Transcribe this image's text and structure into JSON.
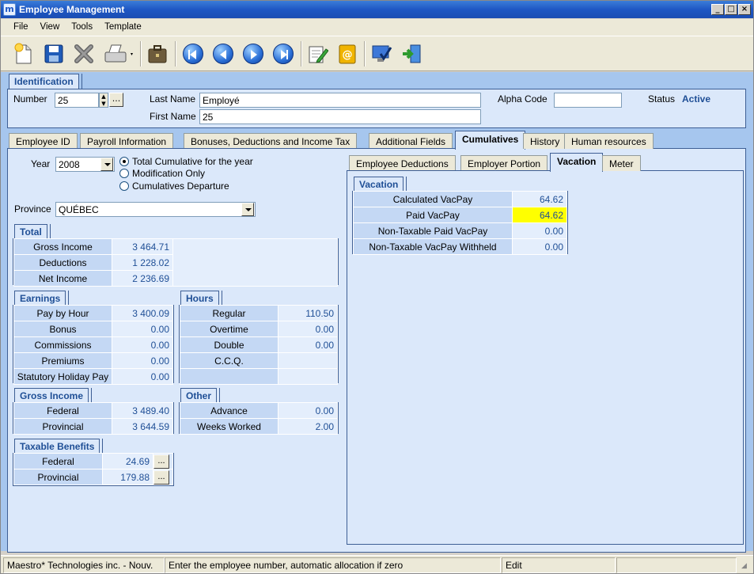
{
  "window": {
    "title": "Employee Management",
    "app_icon": "m"
  },
  "menu": [
    "File",
    "View",
    "Tools",
    "Template"
  ],
  "identification": {
    "caption": "Identification",
    "number_label": "Number",
    "number_value": "25",
    "lastname_label": "Last Name",
    "lastname_value": "Employé",
    "firstname_label": "First Name",
    "firstname_value": "25",
    "alpha_label": "Alpha Code",
    "alpha_value": "",
    "status_label": "Status",
    "status_value": "Active",
    "lookup_label": "..."
  },
  "main_tabs": [
    "Employee ID",
    "Payroll Information",
    "Bonuses, Deductions and Income Tax",
    "Additional Fields",
    "Cumulatives",
    "History",
    "Human resources"
  ],
  "year": {
    "label": "Year",
    "value": "2008"
  },
  "mode_options": [
    "Total Cumulative for the year",
    "Modification Only",
    "Cumulatives Departure"
  ],
  "province": {
    "label": "Province",
    "value": "QUÉBEC"
  },
  "total": {
    "caption": "Total",
    "rows": [
      [
        "Gross Income",
        "3 464.71"
      ],
      [
        "Deductions",
        "1 228.02"
      ],
      [
        "Net Income",
        "2 236.69"
      ]
    ]
  },
  "earnings": {
    "caption": "Earnings",
    "rows": [
      [
        "Pay by Hour",
        "3 400.09"
      ],
      [
        "Bonus",
        "0.00"
      ],
      [
        "Commissions",
        "0.00"
      ],
      [
        "Premiums",
        "0.00"
      ],
      [
        "Statutory Holiday Pay",
        "0.00"
      ]
    ]
  },
  "hours": {
    "caption": "Hours",
    "rows": [
      [
        "Regular",
        "110.50"
      ],
      [
        "Overtime",
        "0.00"
      ],
      [
        "Double",
        "0.00"
      ],
      [
        "C.C.Q.",
        ""
      ],
      [
        "",
        ""
      ]
    ]
  },
  "gross_income": {
    "caption": "Gross Income",
    "rows": [
      [
        "Federal",
        "3 489.40"
      ],
      [
        "Provincial",
        "3 644.59"
      ]
    ]
  },
  "other": {
    "caption": "Other",
    "rows": [
      [
        "Advance",
        "0.00"
      ],
      [
        "Weeks Worked",
        "2.00"
      ]
    ]
  },
  "taxable_benefits": {
    "caption": "Taxable Benefits",
    "rows": [
      [
        "Federal",
        "24.69"
      ],
      [
        "Provincial",
        "179.88"
      ]
    ]
  },
  "sub_tabs": [
    "Employee Deductions",
    "Employer Portion",
    "Vacation",
    "Meter"
  ],
  "vacation": {
    "caption": "Vacation",
    "rows": [
      [
        "Calculated VacPay",
        "64.62"
      ],
      [
        "Paid VacPay",
        "64.62"
      ],
      [
        "Non-Taxable Paid VacPay",
        "0.00"
      ],
      [
        "Non-Taxable VacPay Withheld",
        "0.00"
      ]
    ]
  },
  "status_bar": {
    "company": "Maestro* Technologies inc. - Nouv.",
    "hint": "Enter the employee number, automatic allocation if zero",
    "mode": "Edit"
  },
  "colors": {
    "accent": "#1f4f96",
    "highlight": "#ffff00",
    "background": "#a6c6ee"
  }
}
